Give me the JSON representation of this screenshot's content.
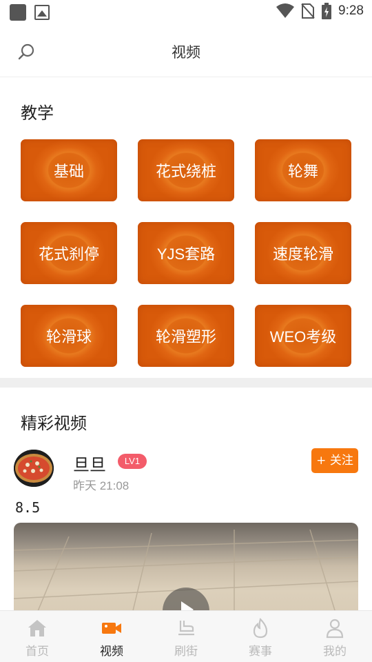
{
  "status_bar": {
    "time": "9:28"
  },
  "header": {
    "title": "视频",
    "search_icon": "search-icon"
  },
  "teaching": {
    "title": "教学",
    "items": [
      {
        "label": "基础"
      },
      {
        "label": "花式绕桩"
      },
      {
        "label": "轮舞"
      },
      {
        "label": "花式刹停"
      },
      {
        "label": "YJS套路"
      },
      {
        "label": "速度轮滑"
      },
      {
        "label": "轮滑球"
      },
      {
        "label": "轮滑塑形"
      },
      {
        "label": "WEO考级"
      }
    ]
  },
  "featured": {
    "title": "精彩视频",
    "post": {
      "username": "旦旦",
      "level": "LV1",
      "time": "昨天 21:08",
      "follow_label": "+ 关注",
      "caption": "8.5"
    }
  },
  "bottom_nav": {
    "items": [
      {
        "label": "首页",
        "icon": "home-icon"
      },
      {
        "label": "视频",
        "icon": "video-icon"
      },
      {
        "label": "刷街",
        "icon": "skate-icon"
      },
      {
        "label": "赛事",
        "icon": "flame-icon"
      },
      {
        "label": "我的",
        "icon": "person-icon"
      }
    ]
  },
  "colors": {
    "accent": "#f7780f",
    "tile": "#e06a14",
    "badge": "#f35c6a",
    "inactive": "#b9b9b9"
  }
}
